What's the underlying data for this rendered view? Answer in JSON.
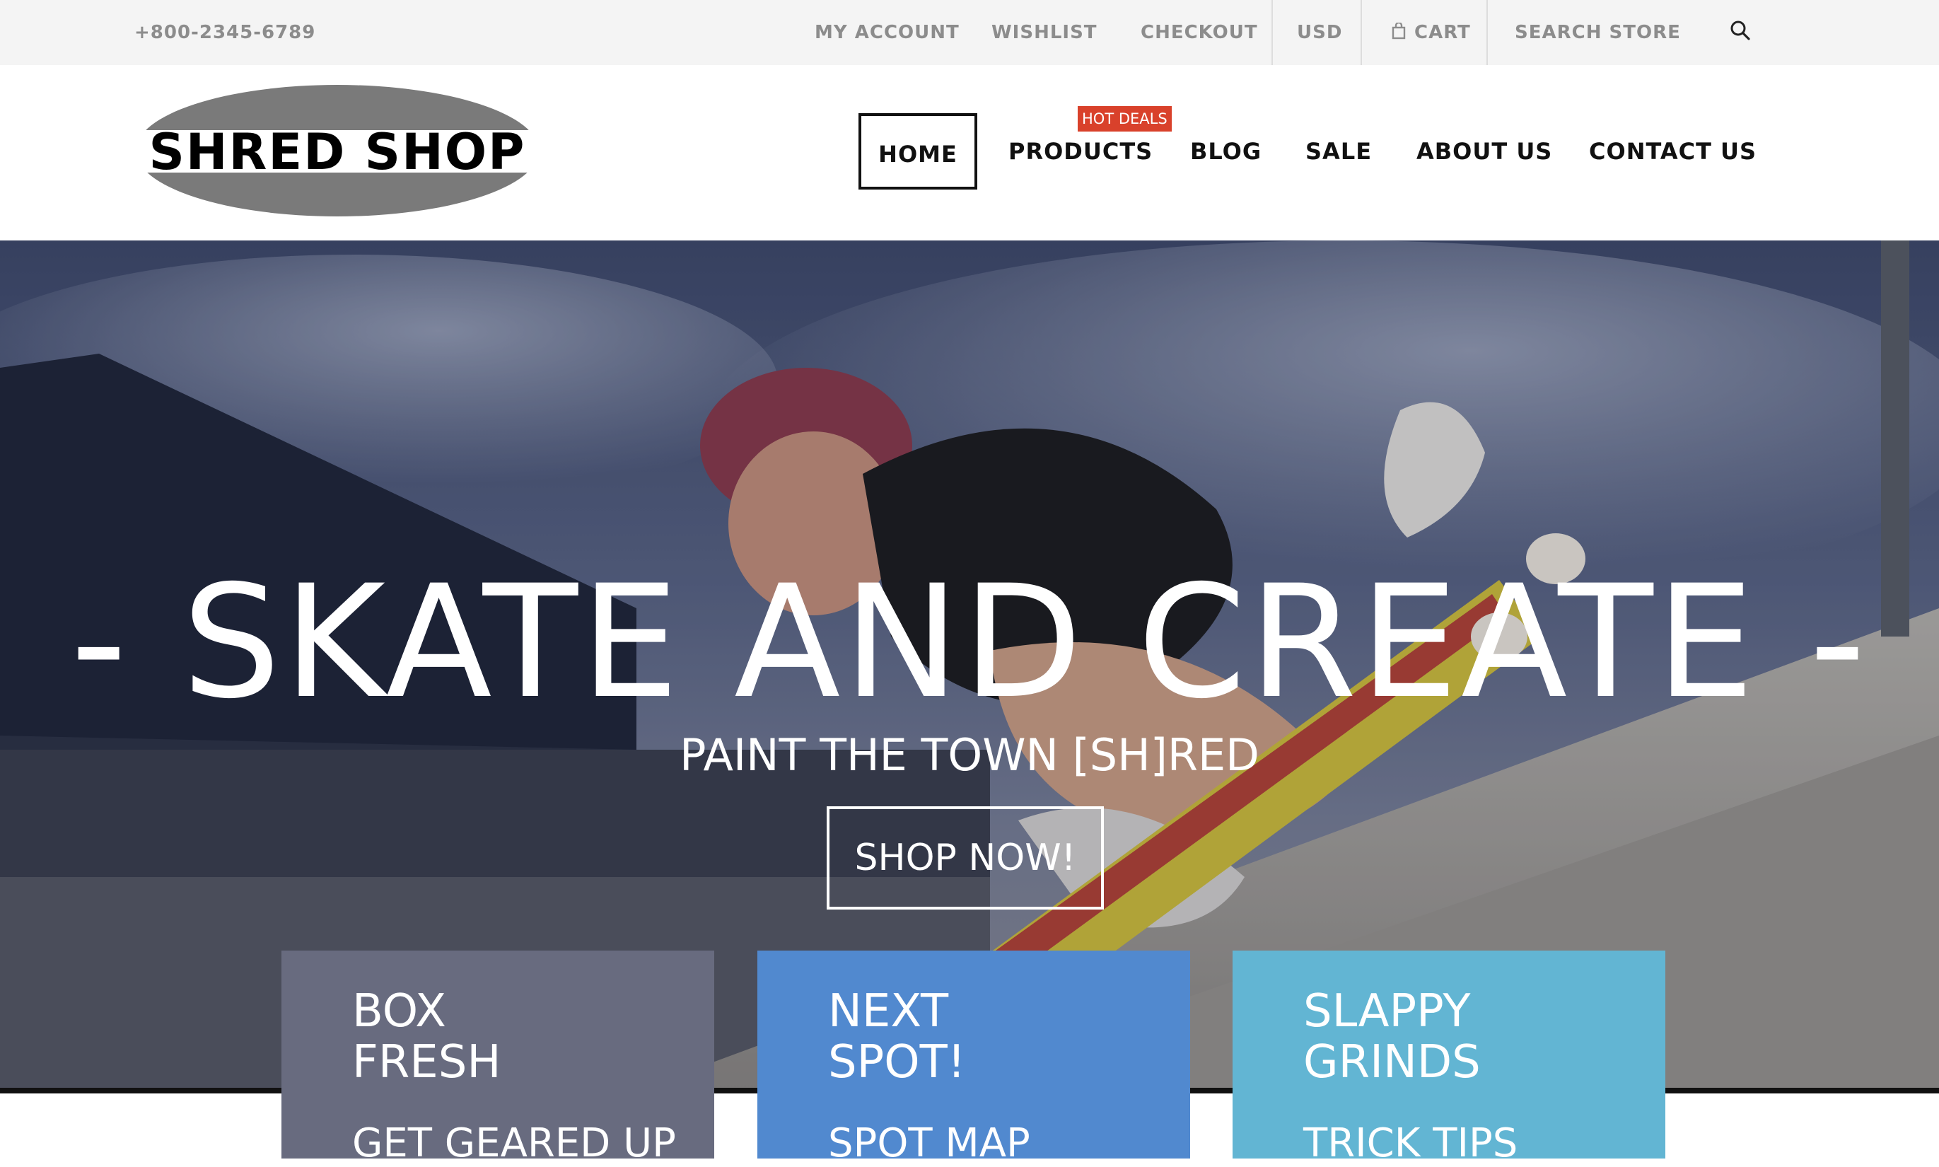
{
  "topbar": {
    "phone": "+800-2345-6789",
    "links": [
      "MY ACCOUNT",
      "WISHLIST",
      "CHECKOUT"
    ],
    "currency": "USD",
    "cart_label": "CART",
    "search_label": "SEARCH STORE",
    "cart_icon": "shopping-bag-icon",
    "search_icon": "magnifier-icon"
  },
  "header": {
    "logo_text": "SHRED SHOP",
    "nav": [
      "HOME",
      "PRODUCTS",
      "BLOG",
      "SALE",
      "ABOUT US",
      "CONTACT US"
    ],
    "badge": "HOT DEALS",
    "active_item": "HOME"
  },
  "hero": {
    "title": "- SKATE AND CREATE -",
    "subtitle": "PAINT THE TOWN [SH]RED",
    "button_label": "SHOP NOW!"
  },
  "cards": [
    {
      "title": "BOX\nFRESH",
      "link": "GET GEARED UP",
      "color": "#686b7f"
    },
    {
      "title": "NEXT\nSPOT!",
      "link": "SPOT MAP",
      "color": "#5189cf"
    },
    {
      "title": "SLAPPY\nGRINDS",
      "link": "TRICK TIPS",
      "color": "#62b5d3"
    }
  ],
  "colors": {
    "topbar_bg": "#f4f4f4",
    "topbar_text": "#8c8c8c",
    "badge_bg": "#d9412b"
  }
}
